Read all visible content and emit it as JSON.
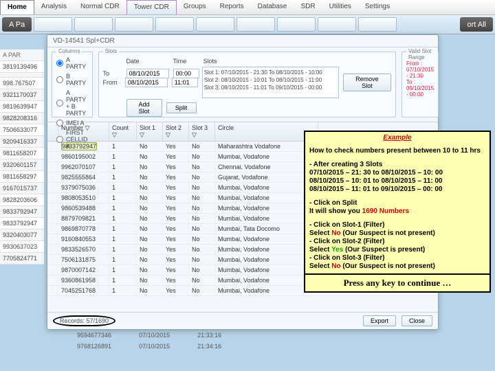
{
  "menu": [
    "Home",
    "Analysis",
    "Normal CDR",
    "Tower CDR",
    "Groups",
    "Reports",
    "Database",
    "SDR",
    "Utilities",
    "Settings"
  ],
  "ribbon": {
    "left_dark": "A Pa",
    "right_dark": "ort All"
  },
  "left_numbers": {
    "hdr": "A PAR",
    "items": [
      "3819139496",
      "",
      "998.767507",
      "9321170037",
      "9819639947",
      "9828208316",
      "7506633077",
      "9209416337",
      "9811658207",
      "9320601157",
      "9811658297",
      "9167015737",
      "9828203606",
      "9833792947",
      "9833792947",
      "9320403077",
      "9930637023",
      "7705824771"
    ]
  },
  "dialog": {
    "title": "VD-14541 Spl+CDR",
    "columns_label": "Columns",
    "columns": [
      "A PARTY",
      "B PARTY",
      "A PARTY + B PARTY",
      "IMEI A",
      "FIRST CELLID A"
    ],
    "slots": {
      "label": "Slots",
      "date_label": "Date",
      "time_label": "Time",
      "slots_label": "Slots",
      "from": "From",
      "to": "To",
      "from_date": "08/10/2015",
      "from_time": "11:01",
      "to_date": "08/10/2015",
      "to_time": "00:00",
      "slot_lines": [
        "Slot 1: 07/10/2015 - 21:30 To 08/10/2015 - 10:00",
        "Slot 2: 08/10/2015 - 10:01 To 08/10/2015 - 11:00",
        "Slot 3: 08/10/2015 - 11:01 To 09/10/2015 - 00:00"
      ],
      "add": "Add Slot",
      "split": "Split",
      "remove": "Remove Slot"
    },
    "valid": {
      "label": "Valid Slot Range",
      "from": "From : 07/10/2015 - 21:30",
      "to": "To     : 09/10/2015 - 00:00"
    },
    "grid": {
      "headers": [
        "",
        "Number ▽",
        "Count ▽",
        "Slot 1 ▽",
        "Slot 2 ▽",
        "Slot 3 ▽",
        "Circle"
      ],
      "rows": [
        [
          "",
          "9833792947",
          "1",
          "No",
          "Yes",
          "No",
          "Maharashtra Vodafone"
        ],
        [
          "",
          "9860195002",
          "1",
          "No",
          "Yes",
          "No",
          "Mumbai, Vodafone"
        ],
        [
          "",
          "9962070107",
          "1",
          "No",
          "Yes",
          "No",
          "Chennai, Vodafone"
        ],
        [
          "",
          "9825555864",
          "1",
          "No",
          "Yes",
          "No",
          "Gujarat, Vodafone"
        ],
        [
          "",
          "9379075036",
          "1",
          "No",
          "Yes",
          "No",
          "Mumbai, Vodafone"
        ],
        [
          "",
          "9808053510",
          "1",
          "No",
          "Yes",
          "No",
          "Mumbai, Vodafone"
        ],
        [
          "",
          "9860539488",
          "1",
          "No",
          "Yes",
          "No",
          "Mumbai, Vodafone"
        ],
        [
          "",
          "8879709821",
          "1",
          "No",
          "Yes",
          "No",
          "Mumbai, Vodafone"
        ],
        [
          "",
          "9869870778",
          "1",
          "No",
          "Yes",
          "No",
          "Mumbai, Tata Docomo"
        ],
        [
          "",
          "9160840553",
          "1",
          "No",
          "Yes",
          "No",
          "Mumbai, Vodafone"
        ],
        [
          "",
          "9833526570",
          "1",
          "No",
          "Yes",
          "No",
          "Mumbai, Vodafone"
        ],
        [
          "",
          "7506131875",
          "1",
          "No",
          "Yes",
          "No",
          "Mumbai, Vodafone"
        ],
        [
          "",
          "9870007142",
          "1",
          "No",
          "Yes",
          "No",
          "Mumbai, Vodafone"
        ],
        [
          "",
          "9360861958",
          "1",
          "No",
          "Yes",
          "No",
          "Mumbai, Vodafone"
        ],
        [
          "",
          "7045251768",
          "1",
          "No",
          "Yes",
          "No",
          "Mumbai, Vodafone"
        ]
      ]
    },
    "records": "Records: 57/1690",
    "export": "Export",
    "close": "Close"
  },
  "example": {
    "title": "Example",
    "intro": "How to check numbers present between 10 to 11 hrs",
    "block1": [
      "- After creating 3 Slots",
      "07/10/2015 – 21: 30 to 08/10/2015 – 10: 00",
      "08/10/2015 – 10: 01 to 08/10/2015 – 11: 00",
      "08/10/2015 – 11: 01 to 09/10/2015 – 00: 00"
    ],
    "block2_a": "- Click on Split",
    "block2_b_pre": "It will show you ",
    "block2_b_num": "1690 Numbers",
    "block3": [
      "- Click on Slot-1 (Filter)",
      "Select ",
      "No",
      "  (Our Suspect is not present)",
      "- Click on Slot-2 (Filter)",
      "Select ",
      "Yes",
      " (Our Suspect is present)",
      "- Click on Slot-3 (Filter)",
      "Select ",
      "No",
      "  (Our Suspect is not present)"
    ],
    "press": "Press any key to continue …"
  },
  "bg_rows": [
    [
      "",
      "9594677346",
      "07/10/2015",
      "21:33:16"
    ],
    [
      "",
      "9768126891",
      "07/10/2015",
      "21:34:16"
    ]
  ]
}
